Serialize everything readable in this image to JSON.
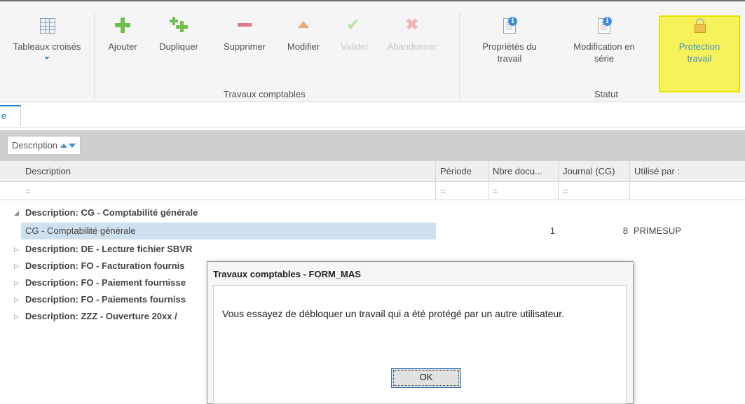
{
  "ribbon": {
    "buttons": {
      "tableaux": "Tableaux croisés",
      "ajouter": "Ajouter",
      "dupliquer": "Dupliquer",
      "supprimer": "Supprimer",
      "modifier": "Modifier",
      "valider": "Valider",
      "abandonner": "Abandonner",
      "proprietes_line1": "Propriétés du",
      "proprietes_line2": "travail",
      "modif_serie_line1": "Modification en",
      "modif_serie_line2": "série",
      "protection_line1": "Protection",
      "protection_line2": "travail"
    },
    "groups": {
      "travaux": "Travaux comptables",
      "statut": "Statut"
    },
    "icons": {
      "tableaux": "pivot-table-icon",
      "ajouter": "add-icon",
      "dupliquer": "duplicate-icon",
      "supprimer": "delete-icon",
      "modifier": "edit-icon",
      "valider": "check-icon",
      "abandonner": "cancel-icon",
      "proprietes": "properties-icon",
      "modif_serie": "batch-edit-icon",
      "protection": "lock-icon"
    },
    "highlight_color": "#f7f25a"
  },
  "tab": {
    "label": "e"
  },
  "group_panel": {
    "chip": "Description"
  },
  "grid": {
    "columns": [
      "Description",
      "Période",
      "Nbre docu...",
      "Journal (CG)",
      "Utilisé par :"
    ],
    "filter_placeholder": "=",
    "groups": [
      "Description: CG - Comptabilité générale",
      "Description: DE - Lecture fichier SBVR",
      "Description: FO - Facturation fournis",
      "Description: FO - Paiement fournisse",
      "Description: FO - Paiements fourniss",
      "Description: ZZZ - Ouverture 20xx /"
    ],
    "row": {
      "description": "CG - Comptabilité générale",
      "nbre": "1",
      "journal": "8",
      "utilise_par": "PRIMESUP"
    }
  },
  "dialog": {
    "title": "Travaux comptables - FORM_MAS",
    "message": "Vous essayez de débloquer un travail qui a été protégé par un autre utilisateur.",
    "ok": "OK"
  }
}
